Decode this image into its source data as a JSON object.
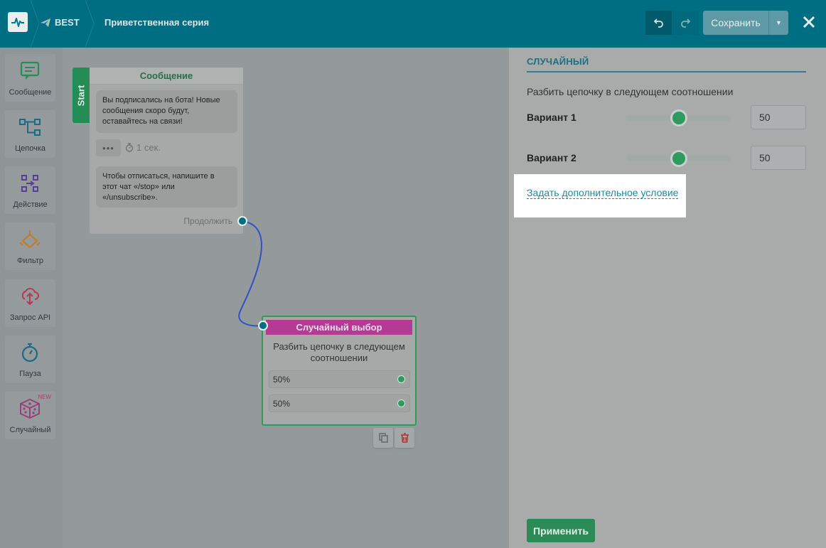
{
  "header": {
    "bot_name": "BEST",
    "flow_title": "Приветственная серия",
    "save_label": "Сохранить"
  },
  "sidebar": {
    "items": [
      {
        "label": "Сообщение",
        "icon": "message-icon"
      },
      {
        "label": "Цепочка",
        "icon": "chain-icon"
      },
      {
        "label": "Действие",
        "icon": "action-icon"
      },
      {
        "label": "Фильтр",
        "icon": "filter-icon"
      },
      {
        "label": "Запрос API",
        "icon": "api-request-icon"
      },
      {
        "label": "Пауза",
        "icon": "pause-icon"
      },
      {
        "label": "Случайный",
        "icon": "dice-icon",
        "badge": "NEW"
      }
    ]
  },
  "canvas": {
    "start_label": "Start",
    "message_node": {
      "title": "Сообщение",
      "bubble1": "Вы подписались на бота! Новые сообщения скоро будут, оставайтесь на связи!",
      "dots": "•••",
      "delay": "1 сек.",
      "bubble2": "Чтобы отписаться, напишите в этот чат «/stop» или «/unsubscribe».",
      "continue_label": "Продолжить"
    },
    "random_node": {
      "title": "Случайный выбор",
      "description": "Разбить цепочку в следующем соотношении",
      "options": [
        "50%",
        "50%"
      ]
    }
  },
  "panel": {
    "title": "СЛУЧАЙНЫЙ",
    "subtitle": "Разбить цепочку в следующем соотношении",
    "variants": [
      {
        "label": "Вариант 1",
        "value": "50",
        "slider_fraction": 0.5
      },
      {
        "label": "Вариант 2",
        "value": "50",
        "slider_fraction": 0.5
      }
    ],
    "extra_condition_link": "Задать дополнительное условие",
    "apply_label": "Применить"
  },
  "colors": {
    "header_bg": "#006e82",
    "accent_green": "#2e9a5e",
    "random_magenta": "#b53a96",
    "link_blue": "#1d8ba3"
  }
}
